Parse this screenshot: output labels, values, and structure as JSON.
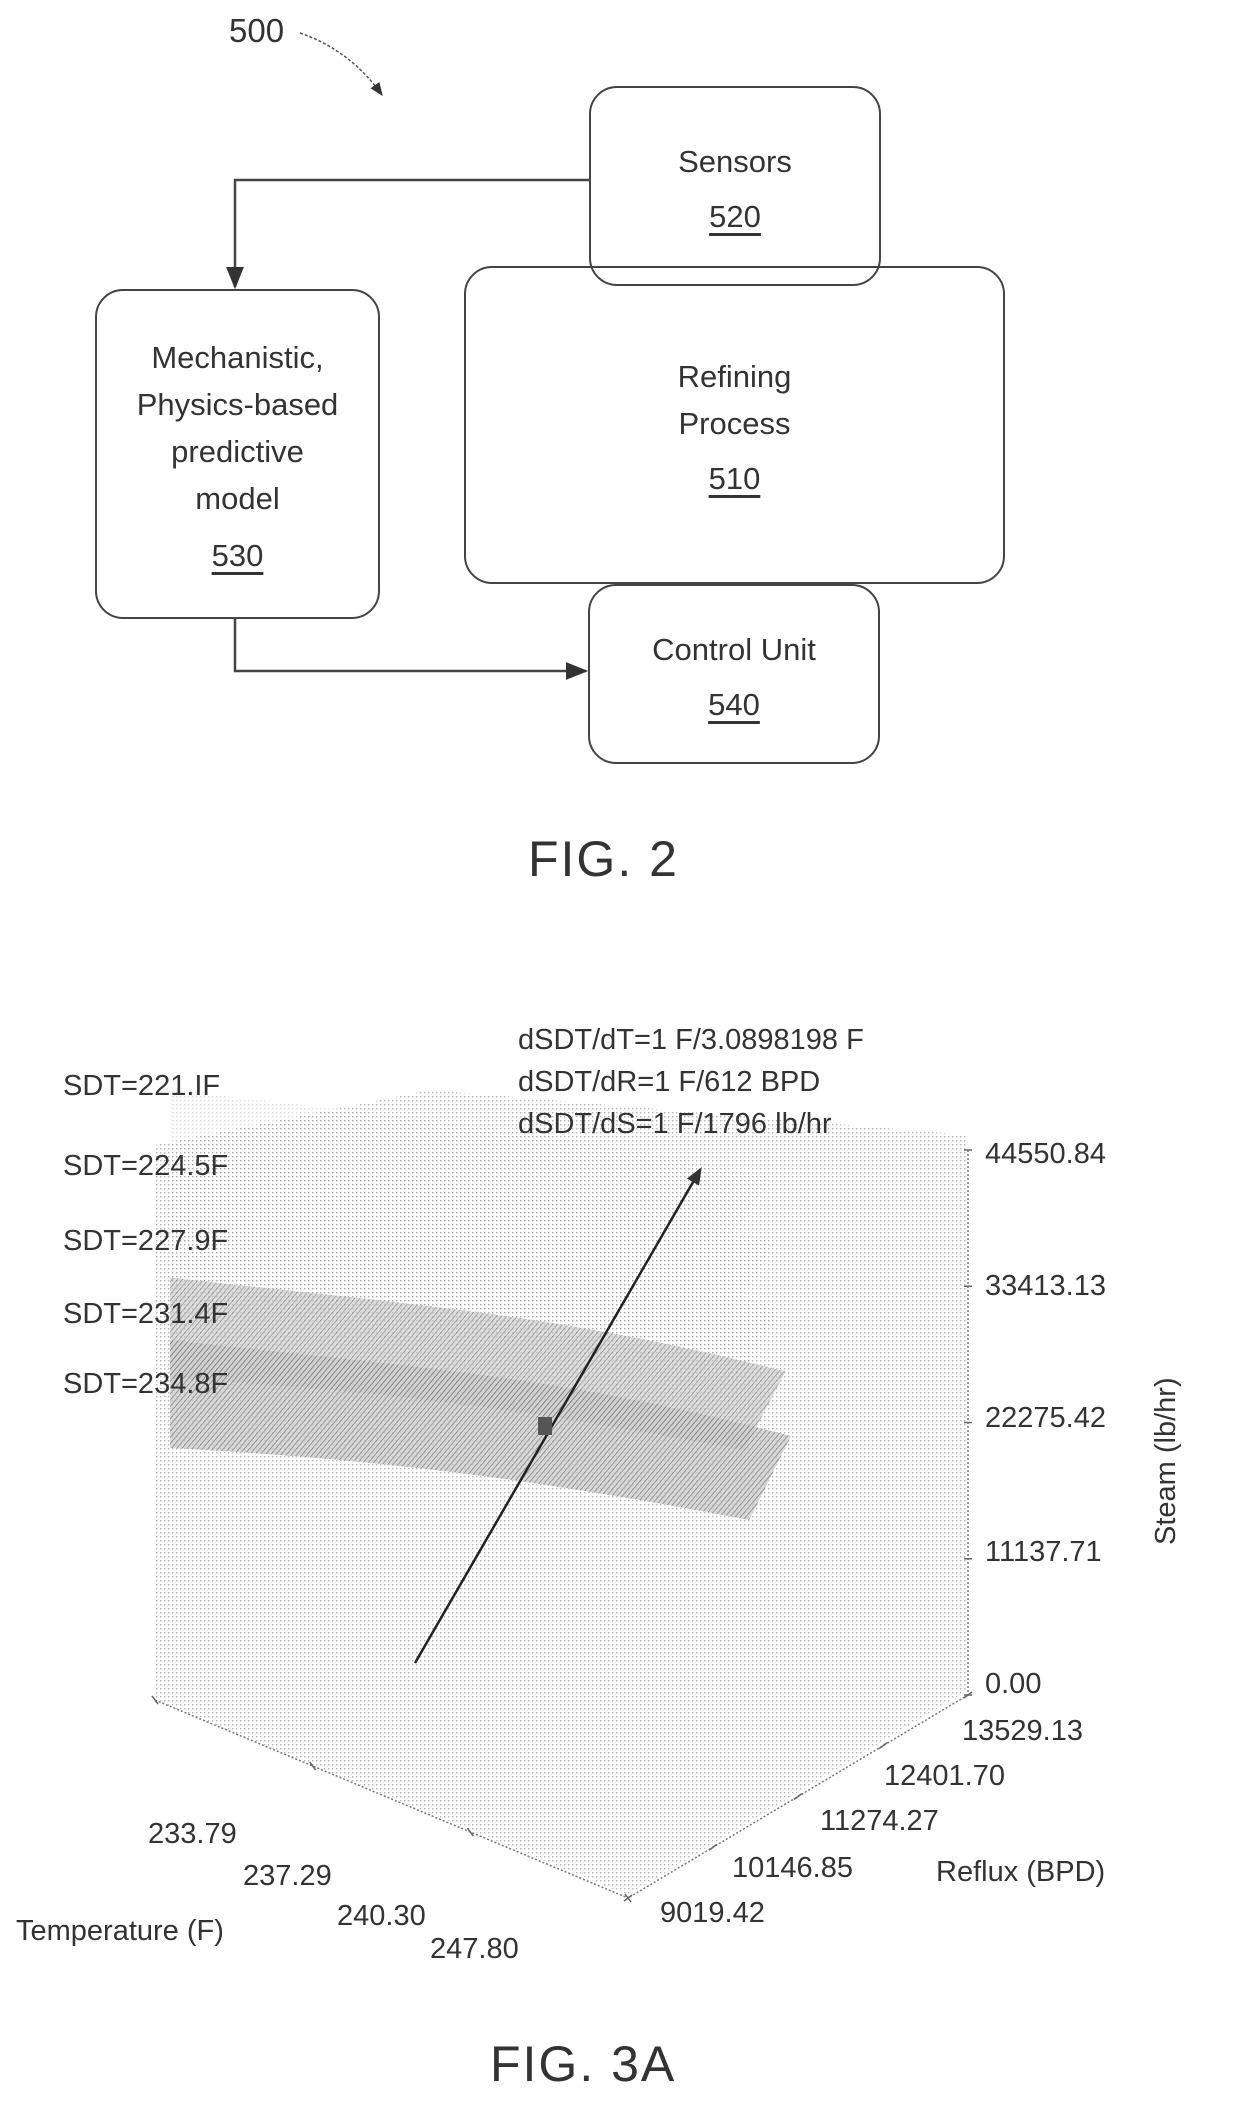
{
  "fig2": {
    "ref_label": "500",
    "boxes": {
      "sensors": {
        "label": "Sensors",
        "ref": "520"
      },
      "refining": {
        "label_lines": [
          "Refining",
          "Process"
        ],
        "ref": "510"
      },
      "model": {
        "label_lines": [
          "Mechanistic,",
          "Physics-based",
          "predictive",
          "model"
        ],
        "ref": "530"
      },
      "control": {
        "label": "Control Unit",
        "ref": "540"
      }
    },
    "caption": "FIG. 2"
  },
  "fig3a": {
    "caption": "FIG. 3A",
    "chart_data": {
      "type": "3d-surface",
      "title": "",
      "annotations": [
        "dSDT/dT=1 F/3.0898198 F",
        "dSDT/dR=1 F/612 BPD",
        "dSDT/dS=1 F/1796 lb/hr"
      ],
      "series": [
        {
          "name": "SDT=221.IF",
          "sdt_F": 221.1
        },
        {
          "name": "SDT=224.5F",
          "sdt_F": 224.5
        },
        {
          "name": "SDT=227.9F",
          "sdt_F": 227.9
        },
        {
          "name": "SDT=231.4F",
          "sdt_F": 231.4
        },
        {
          "name": "SDT=234.8F",
          "sdt_F": 234.8
        }
      ],
      "axes": {
        "x": {
          "label": "Temperature (F)",
          "ticks": [
            "233.79",
            "237.29",
            "240.30",
            "247.80"
          ],
          "range": [
            233.79,
            247.8
          ]
        },
        "y": {
          "label": "Reflux (BPD)",
          "ticks": [
            "9019.42",
            "10146.85",
            "11274.27",
            "12401.70",
            "13529.13"
          ],
          "range": [
            9019.42,
            13529.13
          ]
        },
        "z": {
          "label": "Steam (lb/hr)",
          "ticks": [
            "0.00",
            "11137.71",
            "22275.42",
            "33413.13",
            "44550.84"
          ],
          "range": [
            0.0,
            44550.84
          ]
        }
      },
      "gradient_vector": {
        "description": "arrow through surfaces, pointing toward lower SDT / higher steam"
      },
      "grid": false,
      "legend": "left"
    }
  }
}
